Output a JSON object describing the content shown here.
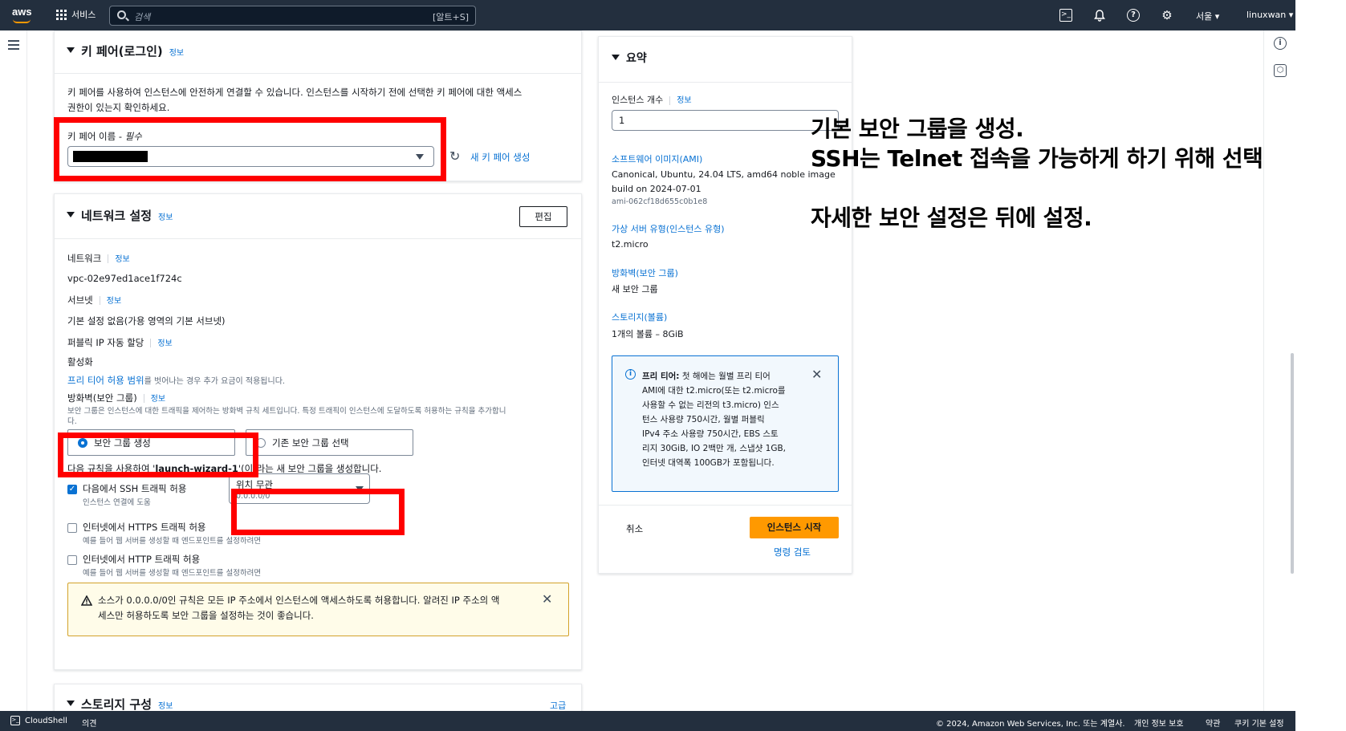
{
  "topbar": {
    "logo": "aws",
    "services": "서비스",
    "search_placeholder": "검색",
    "search_shortcut": "[알트+S]",
    "region": "서울 ▾",
    "user": "linuxwan ▾"
  },
  "keypair": {
    "title": "키 페어(로그인)",
    "info": "정보",
    "description_1": "키 페어를 사용하여 인스턴스에 안전하게 연결할 수 있습니다. 인스턴스를 시작하기 전에 선택한 키 페어에 대한 액세스",
    "description_2": "권한이 있는지 확인하세요.",
    "name_label": "키 페어 이름 - ",
    "required": "필수",
    "create_link": "새 키 페어 생성"
  },
  "network": {
    "title": "네트워크 설정",
    "info": "정보",
    "edit": "편집",
    "network_label": "네트워크",
    "network_value": "vpc-02e97ed1ace1f724c",
    "subnet_label": "서브넷",
    "subnet_value": "기본 설정 없음(가용 영역의 기본 서브넷)",
    "public_ip_label": "퍼블릭 IP 자동 할당",
    "public_ip_value": "활성화",
    "free_tier_link": "프리 티어 허용 범위",
    "free_tier_note": "를 벗어나는 경우 추가 요금이 적용됩니다.",
    "firewall_label": "방화벽(보안 그룹)",
    "firewall_desc": "보안 그룹은 인스턴스에 대한 트래픽을 제어하는 방화벽 규칙 세트입니다. 특정 트래픽이 인스턴스에 도달하도록 허용하는 규칙을 추가합니",
    "firewall_desc_2": "다.",
    "opt_create": "보안 그룹 생성",
    "opt_existing": "기존 보안 그룹 선택",
    "rule_note_pre": "다음 규칙을 사용하여 '",
    "rule_note_name": "launch-wizard-1",
    "rule_note_post": "'(이)라는 새 보안 그룹을 생성합니다.",
    "ssh_label": "다음에서 SSH 트래픽 허용",
    "ssh_sub": "인스턴스 연결에 도움",
    "ssh_source": "위치 무관",
    "ssh_cidr": "0.0.0.0/0",
    "https_label": "인터넷에서 HTTPS 트래픽 허용",
    "https_sub": "예를 들어 웹 서버를 생성할 때 엔드포인트를 설정하려면",
    "http_label": "인터넷에서 HTTP 트래픽 허용",
    "http_sub": "예를 들어 웹 서버를 생성할 때 엔드포인트를 설정하려면",
    "warning_1": "소스가 0.0.0.0/0인 규칙은 모든 IP 주소에서 인스턴스에 액세스하도록 허용합니다. 알려진 IP 주소의 액",
    "warning_2": "세스만 허용하도록 보안 그룹을 설정하는 것이 좋습니다."
  },
  "storage": {
    "title": "스토리지 구성",
    "info": "정보",
    "advanced": "고급"
  },
  "summary": {
    "title": "요약",
    "count_label": "인스턴스 개수",
    "info": "정보",
    "count_value": "1",
    "ami_label": "소프트웨어 이미지(AMI)",
    "ami_value_1": "Canonical, Ubuntu, 24.04 LTS, amd64 noble image",
    "ami_value_2": "build on 2024-07-01",
    "ami_id": "ami-062cf18d655c0b1e8",
    "type_label": "가상 서버 유형(인스턴스 유형)",
    "type_value": "t2.micro",
    "fw_label": "방화벽(보안 그룹)",
    "fw_value": "새 보안 그룹",
    "storage_label": "스토리지(볼륨)",
    "storage_value": "1개의 볼륨 – 8GiB",
    "free_tier_bold": "프리 티어:",
    "free_tier_lines": [
      " 첫 해에는 월별 프리 티어",
      "AMI에 대한 t2.micro(또는 t2.micro를",
      "사용할 수 없는 리전의 t3.micro) 인스",
      "턴스 사용량 750시간, 월별 퍼블릭",
      "IPv4 주소 사용량 750시간, EBS 스토",
      "리지 30GiB, IO 2백만 개, 스냅샷 1GB,",
      "인터넷 대역폭 100GB가 포함됩니다."
    ],
    "cancel": "취소",
    "launch": "인스턴스 시작",
    "review": "명령 검토"
  },
  "annotation": {
    "line1": "기본 보안 그룹을 생성.",
    "line2": "SSH는 Telnet 접속을 가능하게 하기 위해 선택",
    "line3": "자세한 보안 설정은 뒤에 설정."
  },
  "footer": {
    "cloudshell": "CloudShell",
    "feedback": "의견",
    "copyright": "© 2024, Amazon Web Services, Inc. 또는 계열사.",
    "privacy": "개인 정보 보호",
    "terms": "약관",
    "cookies": "쿠키 기본 설정"
  },
  "colors": {
    "topbar": "#232f3e",
    "accent": "#0972d3",
    "launch": "#ff9900",
    "highlight": "#ff0000"
  }
}
